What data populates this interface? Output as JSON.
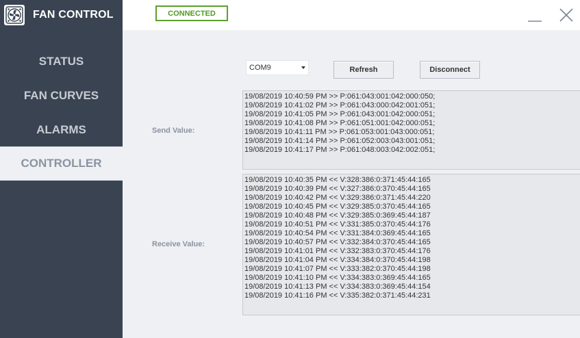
{
  "app": {
    "title": "FAN CONTROL"
  },
  "topbar": {
    "status": "CONNECTED",
    "status_color": "#4f9a22"
  },
  "sidebar": {
    "items": [
      {
        "label": "STATUS",
        "active": false
      },
      {
        "label": "FAN CURVES",
        "active": false
      },
      {
        "label": "ALARMS",
        "active": false
      },
      {
        "label": "CONTROLLER",
        "active": true
      }
    ]
  },
  "controller": {
    "port_selected": "COM9",
    "refresh_label": "Refresh",
    "disconnect_label": "Disconnect",
    "send_label": "Send Value:",
    "receive_label": "Receive Value:",
    "send_log": [
      "19/08/2019 10:40:59 PM >> P:061:043:001:042:000:050;",
      "19/08/2019 10:41:02 PM >> P:061:043:000:042:001:051;",
      "19/08/2019 10:41:05 PM >> P:061:043:001:042:000:051;",
      "19/08/2019 10:41:08 PM >> P:061:051:001:042:000:051;",
      "19/08/2019 10:41:11 PM >> P:061:053:001:043:000:051;",
      "19/08/2019 10:41:14 PM >> P:061:052:003:043:001:051;",
      "19/08/2019 10:41:17 PM >> P:061:048:003:042:002:051;"
    ],
    "receive_log": [
      "19/08/2019 10:40:35 PM << V:328:386:0:371:45:44:165",
      "19/08/2019 10:40:39 PM << V:327:386:0:370:45:44:165",
      "19/08/2019 10:40:42 PM << V:329:386:0:371:45:44:220",
      "19/08/2019 10:40:45 PM << V:329:385:0:370:45:44:165",
      "19/08/2019 10:40:48 PM << V:329:385:0:369:45:44:187",
      "19/08/2019 10:40:51 PM << V:331:385:0:370:45:44:176",
      "19/08/2019 10:40:54 PM << V:331:384:0:369:45:44:165",
      "19/08/2019 10:40:57 PM << V:332:384:0:370:45:44:165",
      "19/08/2019 10:41:01 PM << V:332:383:0:370:45:44:176",
      "19/08/2019 10:41:04 PM << V:334:384:0:370:45:44:198",
      "19/08/2019 10:41:07 PM << V:333:382:0:370:45:44:198",
      "19/08/2019 10:41:10 PM << V:334:383:0:369:45:44:165",
      "19/08/2019 10:41:13 PM << V:334:383:0:369:45:44:154",
      "19/08/2019 10:41:16 PM << V:335:382:0:371:45:44:231"
    ]
  },
  "icons": {
    "logo": "fan-icon",
    "minimize": "minimize-icon",
    "close": "close-icon",
    "dropdown": "chevron-down-icon"
  }
}
